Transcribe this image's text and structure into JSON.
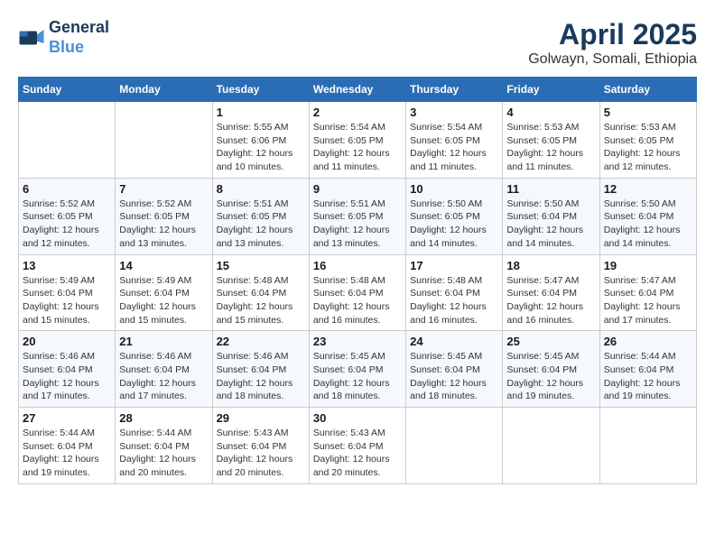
{
  "logo": {
    "line1": "General",
    "line2": "Blue"
  },
  "title": {
    "month_year": "April 2025",
    "location": "Golwayn, Somali, Ethiopia"
  },
  "weekdays": [
    "Sunday",
    "Monday",
    "Tuesday",
    "Wednesday",
    "Thursday",
    "Friday",
    "Saturday"
  ],
  "weeks": [
    [
      null,
      null,
      {
        "day": 1,
        "sunrise": "5:55 AM",
        "sunset": "6:06 PM",
        "daylight": "12 hours and 10 minutes."
      },
      {
        "day": 2,
        "sunrise": "5:54 AM",
        "sunset": "6:05 PM",
        "daylight": "12 hours and 11 minutes."
      },
      {
        "day": 3,
        "sunrise": "5:54 AM",
        "sunset": "6:05 PM",
        "daylight": "12 hours and 11 minutes."
      },
      {
        "day": 4,
        "sunrise": "5:53 AM",
        "sunset": "6:05 PM",
        "daylight": "12 hours and 11 minutes."
      },
      {
        "day": 5,
        "sunrise": "5:53 AM",
        "sunset": "6:05 PM",
        "daylight": "12 hours and 12 minutes."
      }
    ],
    [
      {
        "day": 6,
        "sunrise": "5:52 AM",
        "sunset": "6:05 PM",
        "daylight": "12 hours and 12 minutes."
      },
      {
        "day": 7,
        "sunrise": "5:52 AM",
        "sunset": "6:05 PM",
        "daylight": "12 hours and 13 minutes."
      },
      {
        "day": 8,
        "sunrise": "5:51 AM",
        "sunset": "6:05 PM",
        "daylight": "12 hours and 13 minutes."
      },
      {
        "day": 9,
        "sunrise": "5:51 AM",
        "sunset": "6:05 PM",
        "daylight": "12 hours and 13 minutes."
      },
      {
        "day": 10,
        "sunrise": "5:50 AM",
        "sunset": "6:05 PM",
        "daylight": "12 hours and 14 minutes."
      },
      {
        "day": 11,
        "sunrise": "5:50 AM",
        "sunset": "6:04 PM",
        "daylight": "12 hours and 14 minutes."
      },
      {
        "day": 12,
        "sunrise": "5:50 AM",
        "sunset": "6:04 PM",
        "daylight": "12 hours and 14 minutes."
      }
    ],
    [
      {
        "day": 13,
        "sunrise": "5:49 AM",
        "sunset": "6:04 PM",
        "daylight": "12 hours and 15 minutes."
      },
      {
        "day": 14,
        "sunrise": "5:49 AM",
        "sunset": "6:04 PM",
        "daylight": "12 hours and 15 minutes."
      },
      {
        "day": 15,
        "sunrise": "5:48 AM",
        "sunset": "6:04 PM",
        "daylight": "12 hours and 15 minutes."
      },
      {
        "day": 16,
        "sunrise": "5:48 AM",
        "sunset": "6:04 PM",
        "daylight": "12 hours and 16 minutes."
      },
      {
        "day": 17,
        "sunrise": "5:48 AM",
        "sunset": "6:04 PM",
        "daylight": "12 hours and 16 minutes."
      },
      {
        "day": 18,
        "sunrise": "5:47 AM",
        "sunset": "6:04 PM",
        "daylight": "12 hours and 16 minutes."
      },
      {
        "day": 19,
        "sunrise": "5:47 AM",
        "sunset": "6:04 PM",
        "daylight": "12 hours and 17 minutes."
      }
    ],
    [
      {
        "day": 20,
        "sunrise": "5:46 AM",
        "sunset": "6:04 PM",
        "daylight": "12 hours and 17 minutes."
      },
      {
        "day": 21,
        "sunrise": "5:46 AM",
        "sunset": "6:04 PM",
        "daylight": "12 hours and 17 minutes."
      },
      {
        "day": 22,
        "sunrise": "5:46 AM",
        "sunset": "6:04 PM",
        "daylight": "12 hours and 18 minutes."
      },
      {
        "day": 23,
        "sunrise": "5:45 AM",
        "sunset": "6:04 PM",
        "daylight": "12 hours and 18 minutes."
      },
      {
        "day": 24,
        "sunrise": "5:45 AM",
        "sunset": "6:04 PM",
        "daylight": "12 hours and 18 minutes."
      },
      {
        "day": 25,
        "sunrise": "5:45 AM",
        "sunset": "6:04 PM",
        "daylight": "12 hours and 19 minutes."
      },
      {
        "day": 26,
        "sunrise": "5:44 AM",
        "sunset": "6:04 PM",
        "daylight": "12 hours and 19 minutes."
      }
    ],
    [
      {
        "day": 27,
        "sunrise": "5:44 AM",
        "sunset": "6:04 PM",
        "daylight": "12 hours and 19 minutes."
      },
      {
        "day": 28,
        "sunrise": "5:44 AM",
        "sunset": "6:04 PM",
        "daylight": "12 hours and 20 minutes."
      },
      {
        "day": 29,
        "sunrise": "5:43 AM",
        "sunset": "6:04 PM",
        "daylight": "12 hours and 20 minutes."
      },
      {
        "day": 30,
        "sunrise": "5:43 AM",
        "sunset": "6:04 PM",
        "daylight": "12 hours and 20 minutes."
      },
      null,
      null,
      null
    ]
  ],
  "labels": {
    "sunrise": "Sunrise:",
    "sunset": "Sunset:",
    "daylight": "Daylight:"
  }
}
